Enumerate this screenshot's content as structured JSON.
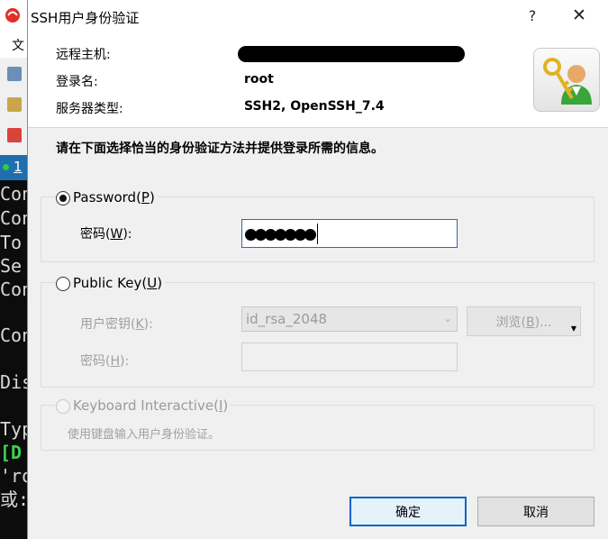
{
  "terminal": {
    "menu_item": "文",
    "tab_label": "1",
    "lines": [
      {
        "text": "Con",
        "green": false
      },
      {
        "text": "Con",
        "green": false
      },
      {
        "text": "To ",
        "green": false
      },
      {
        "text": "Se ",
        "green": false
      },
      {
        "text": "Con",
        "green": false
      },
      {
        "text": "Con",
        "green": false
      },
      {
        "text": "Dis",
        "green": false
      },
      {
        "text": "Typ",
        "green": false
      },
      {
        "text": "[D ",
        "green": true
      },
      {
        "text": "'ro",
        "green": false
      },
      {
        "text": "或:",
        "green": false
      }
    ]
  },
  "dialog": {
    "title": "SSH用户身份验证",
    "help": "?",
    "close": "✕",
    "header": {
      "host_label": "远程主机:",
      "login_label": "登录名:",
      "login_value": "root",
      "server_type_label": "服务器类型:",
      "server_type_value": "SSH2, OpenSSH_7.4"
    },
    "instruction": "请在下面选择恰当的身份验证方法并提供登录所需的信息。",
    "password_method": {
      "label_prefix": "Password(",
      "label_key": "P",
      "label_suffix": ")",
      "selected": true,
      "field_label_prefix": "密码(",
      "field_label_key": "W",
      "field_label_suffix": "):",
      "masked_length": 7
    },
    "public_key_method": {
      "label_prefix": "Public Key(",
      "label_key": "U",
      "label_suffix": ")",
      "selected": false,
      "key_label_prefix": "用户密钥(",
      "key_label_key": "K",
      "key_label_suffix": "):",
      "key_value": "id_rsa_2048",
      "browse_prefix": "浏览(",
      "browse_key": "B",
      "browse_suffix": ")...",
      "passphrase_label_prefix": "密码(",
      "passphrase_label_key": "H",
      "passphrase_label_suffix": "):"
    },
    "keyboard_interactive": {
      "label_prefix": "Keyboard Interactive(",
      "label_key": "I",
      "label_suffix": ")",
      "selected": false,
      "description": "使用键盘输入用户身份验证。"
    },
    "ok_label": "确定",
    "cancel_label": "取消"
  }
}
